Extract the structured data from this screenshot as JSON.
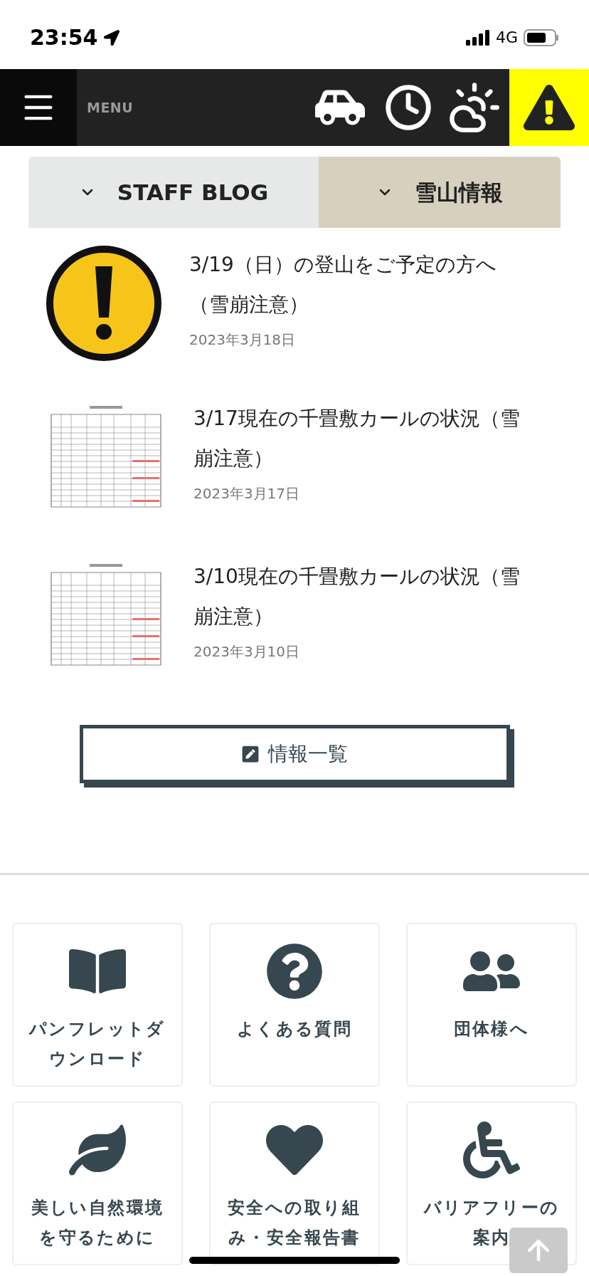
{
  "status_bar": {
    "time": "23:54",
    "network": "4G"
  },
  "header": {
    "menu_label": "MENU"
  },
  "tabs": [
    {
      "label": "STAFF BLOG",
      "selected": false
    },
    {
      "label": "雪山情報",
      "selected": true
    }
  ],
  "posts": [
    {
      "kind": "warning",
      "title": "3/19（日）の登山をご予定の方へ（雪崩注意）",
      "date": "2023年3月18日"
    },
    {
      "kind": "picture",
      "title": "3/17現在の千畳敷カールの状況（雪崩注意）",
      "date": "2023年3月17日"
    },
    {
      "kind": "picture",
      "title": "3/10現在の千畳敷カールの状況（雪崩注意）",
      "date": "2023年3月10日"
    }
  ],
  "list_button": {
    "label": "情報一覧"
  },
  "links": [
    {
      "kind": "book",
      "label": "パンフレットダウンロード"
    },
    {
      "kind": "question",
      "label": "よくある質問"
    },
    {
      "kind": "group",
      "label": "団体様へ"
    },
    {
      "kind": "leaf",
      "label": "美しい自然環境を守るために"
    },
    {
      "kind": "heart",
      "label": "安全への取り組み・安全報告書"
    },
    {
      "kind": "wheelchair",
      "label": "バリアフリーの案内"
    }
  ]
}
